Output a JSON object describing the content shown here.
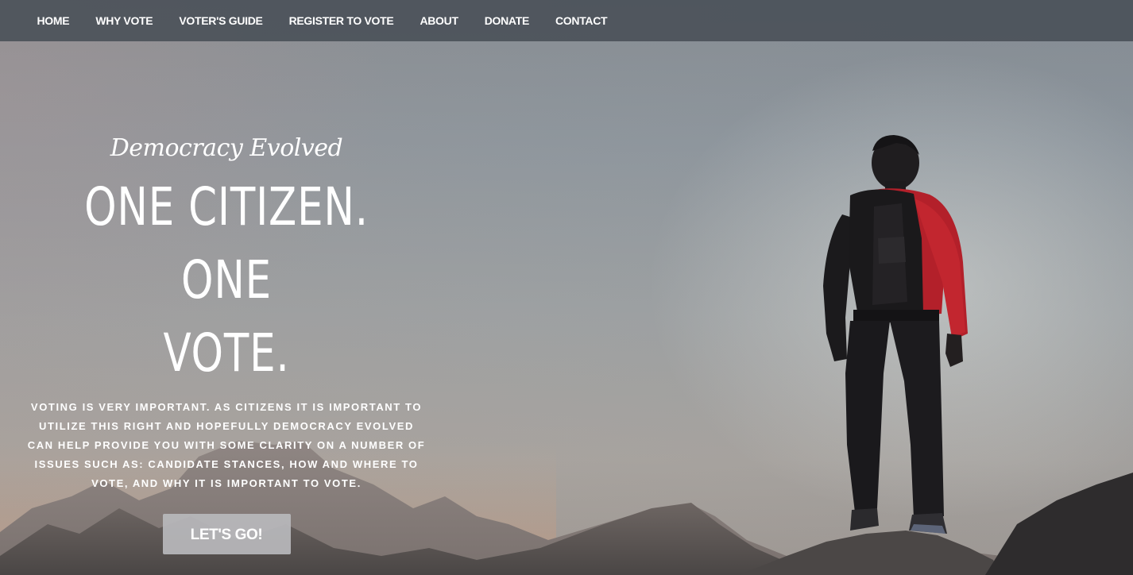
{
  "nav": {
    "items": [
      {
        "label": "HOME"
      },
      {
        "label": "WHY VOTE"
      },
      {
        "label": "VOTER'S GUIDE"
      },
      {
        "label": "REGISTER TO VOTE"
      },
      {
        "label": "ABOUT"
      },
      {
        "label": "DONATE"
      },
      {
        "label": "CONTACT"
      }
    ]
  },
  "hero": {
    "tagline": "Democracy Evolved",
    "headline_line1": "ONE CITIZEN. ONE",
    "headline_line2": "VOTE.",
    "description": "VOTING IS VERY IMPORTANT. AS CITIZENS IT IS IMPORTANT TO UTILIZE THIS RIGHT AND HOPEFULLY DEMOCRACY EVOLVED CAN HELP PROVIDE YOU WITH SOME CLARITY ON A NUMBER OF ISSUES SUCH AS: CANDIDATE STANCES, HOW AND WHERE TO VOTE, AND WHY IT IS IMPORTANT TO VOTE.",
    "cta_label": "LET'S GO!"
  },
  "colors": {
    "nav_background": "#484e56",
    "text": "#ffffff",
    "cta_background": "#b9b9bc",
    "jacket_red": "#b8202a"
  }
}
